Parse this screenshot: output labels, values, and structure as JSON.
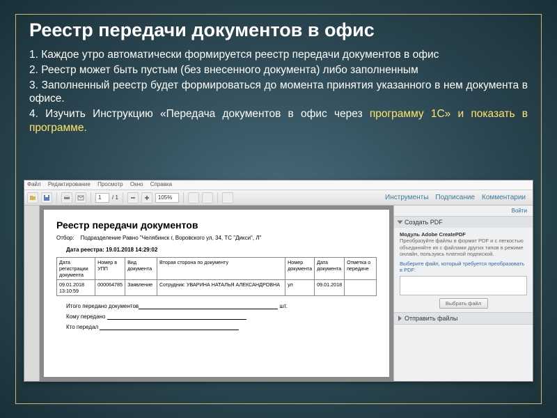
{
  "slide": {
    "title": "Реестр передачи документов в офис",
    "p1": "1. Каждое утро автоматически формируется реестр передачи документов  в офис",
    "p2": "2. Реестр может быть  пустым (без  внесенного документа)  либо заполненным",
    "p3": "3. Заполненный реестр будет формироваться до момента принятия указанного в нем документа в офисе.",
    "p4a": "4. Изучить Инструкцию «Передача документов в офис через ",
    "p4b": "программу 1С» и показать в программе."
  },
  "menu": {
    "file": "Файл",
    "edit": "Редактирование",
    "view": "Просмотр",
    "window": "Окно",
    "help": "Справка"
  },
  "toolbar": {
    "page_cur": "1",
    "page_sep": "/ 1",
    "zoom": "105%",
    "tools": "Инструменты",
    "sign": "Подписание",
    "comments": "Комментарии"
  },
  "right": {
    "login": "Войти",
    "create_head": "Создать PDF",
    "create_title": "Модуль Adobe CreatePDF",
    "create_desc": "Преобразуйте файлы в формат PDF и с легкостью объединяйте их с файлами других типов в режиме онлайн, пользуясь платной подпиской.",
    "select_label": "Выберите файл, который требуется преобразовать в PDF:",
    "choose_btn": "Выбрать файл",
    "send_head": "Отправить файлы"
  },
  "doc": {
    "title": "Реестр передачи документов",
    "filter_label": "Отбор:",
    "filter_value": "Подразделение Равно \"Челябинск г, Воровского ул, 34, ТС \"Дикси\", Л\"",
    "date_label": "Дата реестра: 19.01.2018 14:29:02",
    "cols": {
      "c1": "Дата регистрации документа",
      "c2": "Номер в УПП",
      "c3": "Вид документа",
      "c4": "Вторая сторона по документу",
      "c5": "Номер документа",
      "c6": "Дата документа",
      "c7": "Отметка о передаче"
    },
    "row": {
      "c1": "09.01.2018 13:10:59",
      "c2": "000064785",
      "c3": "Заявление",
      "c4": "Сотрудник: УВАРИНА НАТАЛЬЯ АЛЕКСАНДРОВНА",
      "c5": "ул",
      "c6": "09.01.2018",
      "c7": ""
    },
    "total_label": "Итого передано документов",
    "total_unit": "шт.",
    "to_whom": "Кому передано",
    "who": "Кто передал"
  }
}
